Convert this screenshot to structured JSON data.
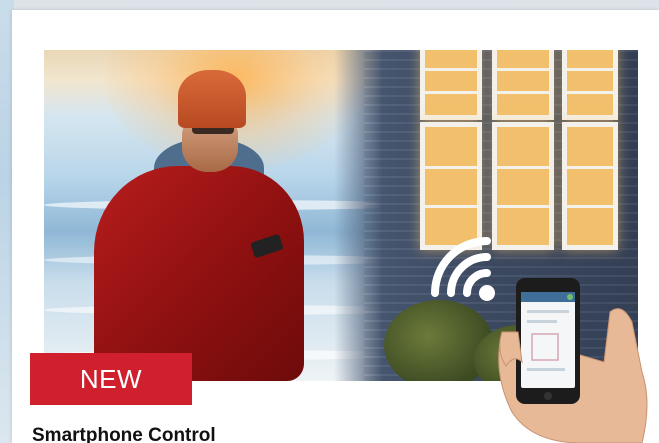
{
  "badge": {
    "label": "NEW",
    "color": "#d0202e"
  },
  "card": {
    "title": "Smartphone Control"
  },
  "hero": {
    "icons": [
      "wifi-signal-icon",
      "smartphone-icon"
    ]
  },
  "colors": {
    "accent": "#d0202e",
    "text": "#111111",
    "card_background": "#ffffff"
  }
}
